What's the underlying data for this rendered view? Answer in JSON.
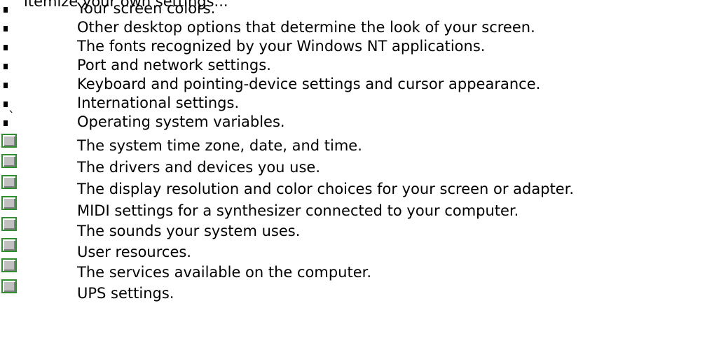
{
  "top_fragment": "itemize your own settings...",
  "items": [
    {
      "icon": "bullet",
      "text": "Your screen colors."
    },
    {
      "icon": "bullet",
      "text": "Other desktop options that determine the look of your screen."
    },
    {
      "icon": "bullet",
      "text": "The fonts recognized by your Windows NT applications."
    },
    {
      "icon": "bullet",
      "text": "Port and network settings."
    },
    {
      "icon": "bullet",
      "text": "Keyboard and pointing-device settings and cursor appearance."
    },
    {
      "icon": "bullet",
      "text": "International settings."
    },
    {
      "icon": "bullet-backtick",
      "text": "Operating system variables."
    },
    {
      "icon": "control-panel-button",
      "text": "The system time zone, date, and time."
    },
    {
      "icon": "control-panel-button",
      "text": "The drivers and devices you use."
    },
    {
      "icon": "control-panel-button",
      "text": "The display resolution and color choices for your screen or adapter."
    },
    {
      "icon": "control-panel-button",
      "text": "MIDI settings for a synthesizer connected to your computer."
    },
    {
      "icon": "control-panel-button",
      "text": "The sounds your system uses."
    },
    {
      "icon": "control-panel-button",
      "text": "User resources."
    },
    {
      "icon": "control-panel-button",
      "text": "The services available on the computer."
    },
    {
      "icon": "control-panel-button",
      "text": "UPS settings."
    }
  ]
}
